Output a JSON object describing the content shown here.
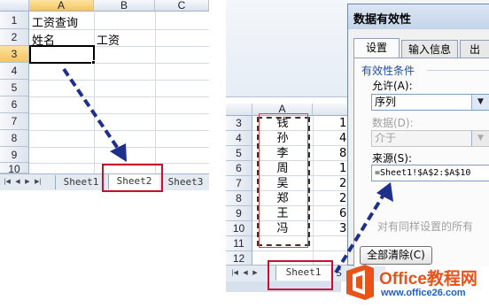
{
  "left_sheet": {
    "name_box_col": "A",
    "columns": [
      "A",
      "B",
      "C"
    ],
    "rows": [
      "1",
      "2",
      "3",
      "4",
      "5",
      "6",
      "7",
      "8",
      "9",
      "10"
    ],
    "cells": {
      "a1": "工资查询",
      "a2": "姓名",
      "b2": "工资"
    },
    "tabs": [
      "Sheet1",
      "Sheet2",
      "Sheet3"
    ],
    "active_tab": "Sheet2",
    "nav_glyphs": [
      "|◀",
      "◀",
      "▶",
      "▶|"
    ]
  },
  "right_sheet": {
    "column_a": "A",
    "rows": [
      "3",
      "4",
      "5",
      "6",
      "7",
      "8",
      "9",
      "10",
      "11",
      "12"
    ],
    "names": [
      "钱",
      "孙",
      "李",
      "周",
      "吴",
      "郑",
      "王",
      "冯"
    ],
    "partial_values": [
      "1",
      "4",
      "8",
      "1",
      "2",
      "2",
      "6",
      "3"
    ],
    "tabs": [
      "Sheet1",
      "S"
    ],
    "nav_glyphs": [
      "|◀",
      "◀",
      "▶"
    ]
  },
  "dialog": {
    "title": "数据有效性",
    "tabs": [
      "设置",
      "输入信息",
      "出"
    ],
    "section_label": "有效性条件",
    "allow_label": "允许(A):",
    "allow_value": "序列",
    "data_label": "数据(D):",
    "data_value": "介于",
    "source_label": "来源(S):",
    "source_value": "=Sheet1!$A$2:$A$10",
    "apply_all_label": "对有同样设置的所有",
    "clear_button": "全部清除(C)"
  },
  "watermark": {
    "brand": "Office教程网",
    "url": "www.office26.com"
  },
  "colors": {
    "highlight_red": "#c8102e",
    "arrow_blue": "#1f2f8c",
    "logo_orange": "#e8531a"
  }
}
